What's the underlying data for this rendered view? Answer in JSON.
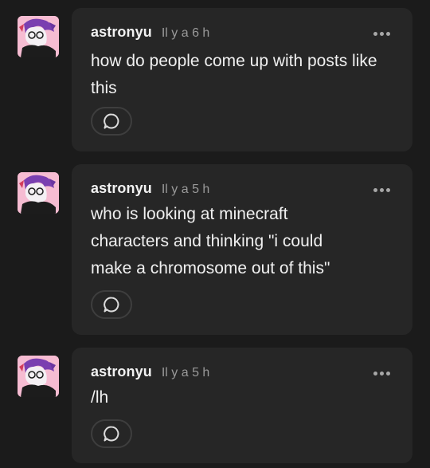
{
  "posts": [
    {
      "author": "astronyu",
      "time": "Il y a 6 h",
      "text": "how do people come up with posts like this",
      "avatar_icon": "user-avatar",
      "more_icon": "more-dots-icon",
      "reply_icon": "speech-bubble-icon"
    },
    {
      "author": "astronyu",
      "time": "Il y a 5 h",
      "text": "who is looking at minecraft characters and thinking \"i could make a chromosome out of this\"",
      "avatar_icon": "user-avatar",
      "more_icon": "more-dots-icon",
      "reply_icon": "speech-bubble-icon"
    },
    {
      "author": "astronyu",
      "time": "Il y a 5 h",
      "text": "/lh",
      "avatar_icon": "user-avatar",
      "more_icon": "more-dots-icon",
      "reply_icon": "speech-bubble-icon"
    }
  ],
  "colors": {
    "background": "#1b1b1b",
    "card": "#262626",
    "text": "#f0f0f0",
    "muted": "#9a9a9a"
  }
}
